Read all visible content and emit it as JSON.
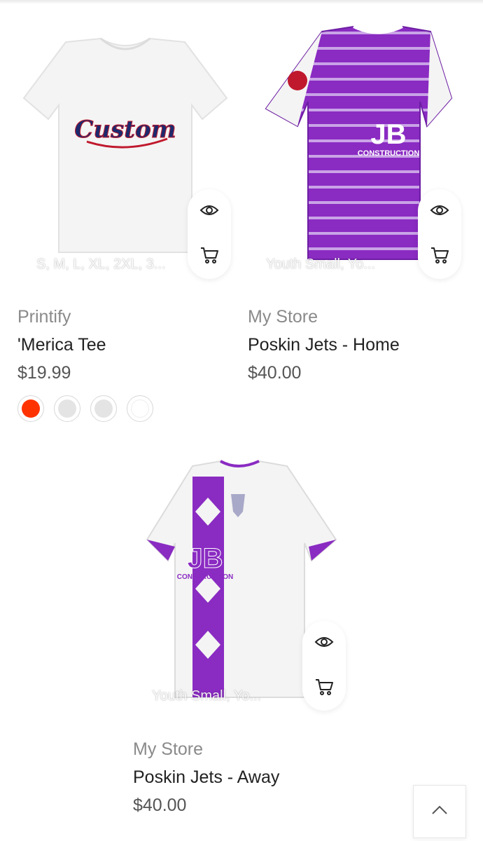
{
  "products": [
    {
      "vendor": "Printify",
      "title": "'Merica Tee",
      "price": "$19.99",
      "sizes": "S, M, L, XL, 2XL, 3...",
      "image_text": "Custom",
      "swatches": [
        "#ff3300",
        "#e4e4e4",
        "#e4e4e4",
        "#ffffff"
      ]
    },
    {
      "vendor": "My Store",
      "title": "Poskin Jets - Home",
      "price": "$40.00",
      "sizes": "Youth Small, Yo...",
      "image_text": "JB CONSTRUCTION"
    },
    {
      "vendor": "My Store",
      "title": "Poskin Jets - Away",
      "price": "$40.00",
      "sizes": "Youth Small, Yo...",
      "image_text": "JB CONSTRUCTION"
    }
  ],
  "icons": {
    "quick_view": "eye-icon",
    "add_to_cart": "cart-icon",
    "back_to_top": "chevron-up-icon"
  },
  "colors": {
    "jersey_purple": "#8a2bc2",
    "swatch_red": "#ff3300"
  }
}
